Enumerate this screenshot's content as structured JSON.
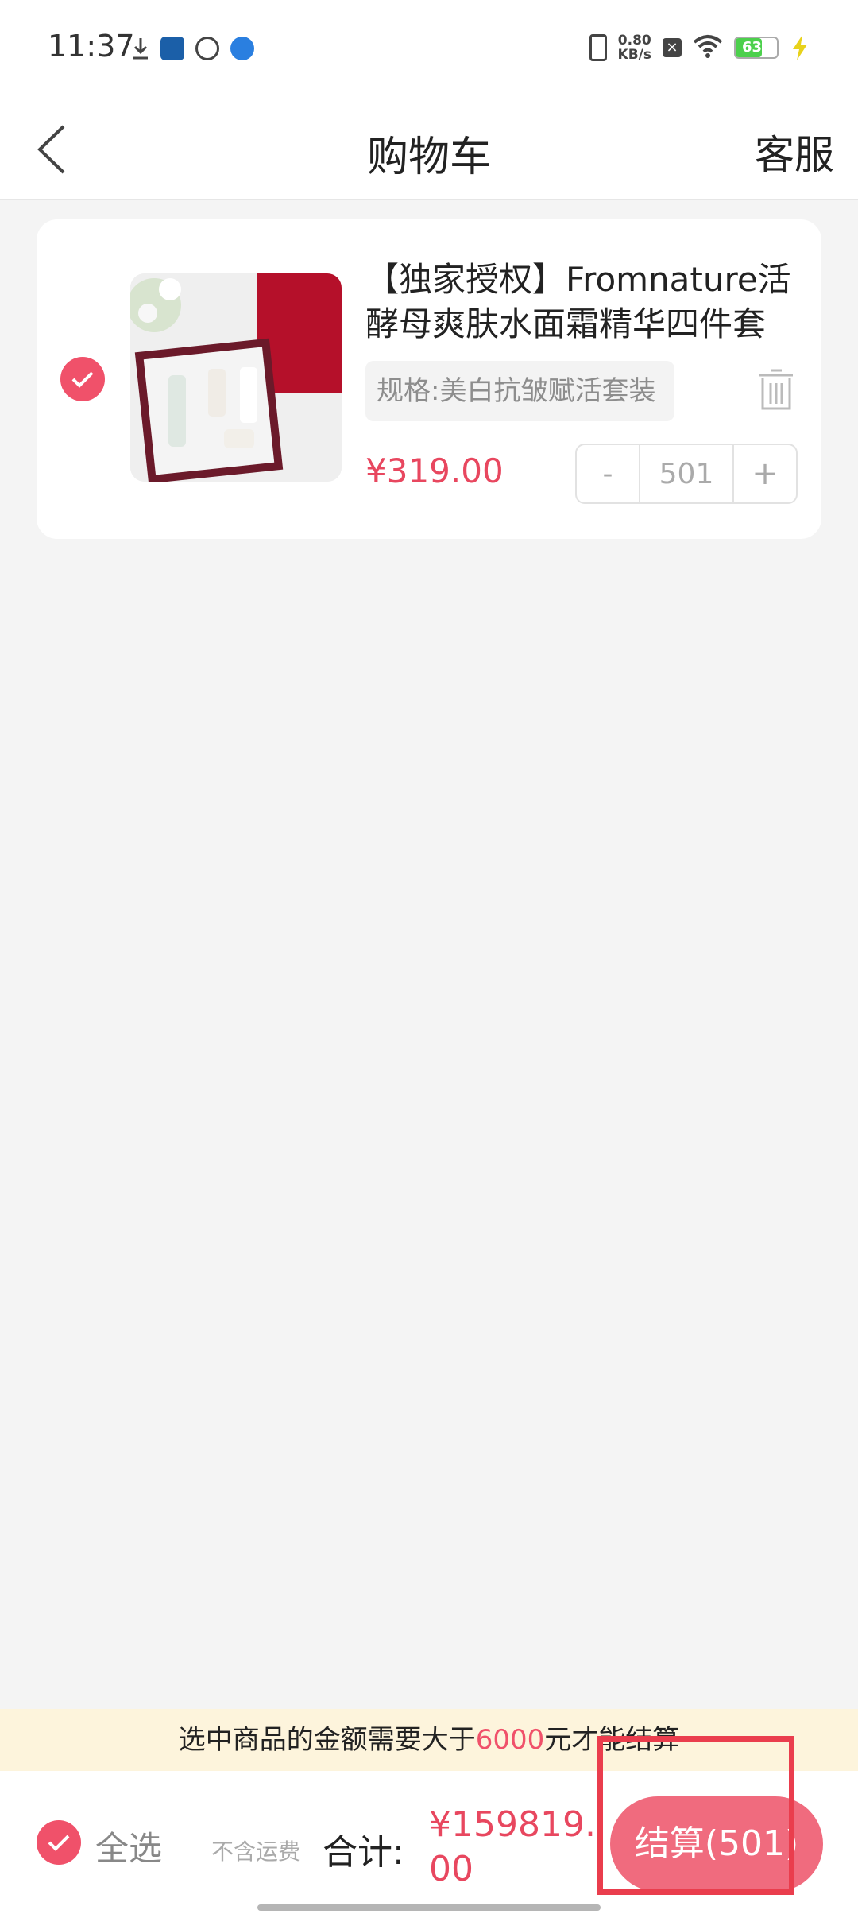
{
  "status_bar": {
    "time": "11:37",
    "net_speed_value": "0.80",
    "net_speed_unit": "KB/s",
    "battery_level": "63"
  },
  "header": {
    "title": "购物车",
    "service_label": "客服"
  },
  "cart": {
    "items": [
      {
        "title": "【独家授权】Fromnature活酵母爽肤水面霜精华四件套",
        "spec": "规格:美白抗皱赋活套装",
        "price": "¥319.00",
        "quantity": "501",
        "minus_label": "-",
        "plus_label": "+",
        "checked": true
      }
    ]
  },
  "notice": {
    "prefix": "选中商品的金额需要大于",
    "amount": "6000",
    "suffix": "元才能结算"
  },
  "bottom_bar": {
    "select_all_label": "全选",
    "shipping_note": "不含运费",
    "total_label": "合计:",
    "total_value": "¥159819.00",
    "checkout_label": "结算(501)"
  },
  "colors": {
    "accent": "#f0516a",
    "price": "#e8475f",
    "checkout_button": "#f06b7e",
    "notice_bg": "#fdf4dc",
    "highlight_box": "#ea3d4d"
  }
}
